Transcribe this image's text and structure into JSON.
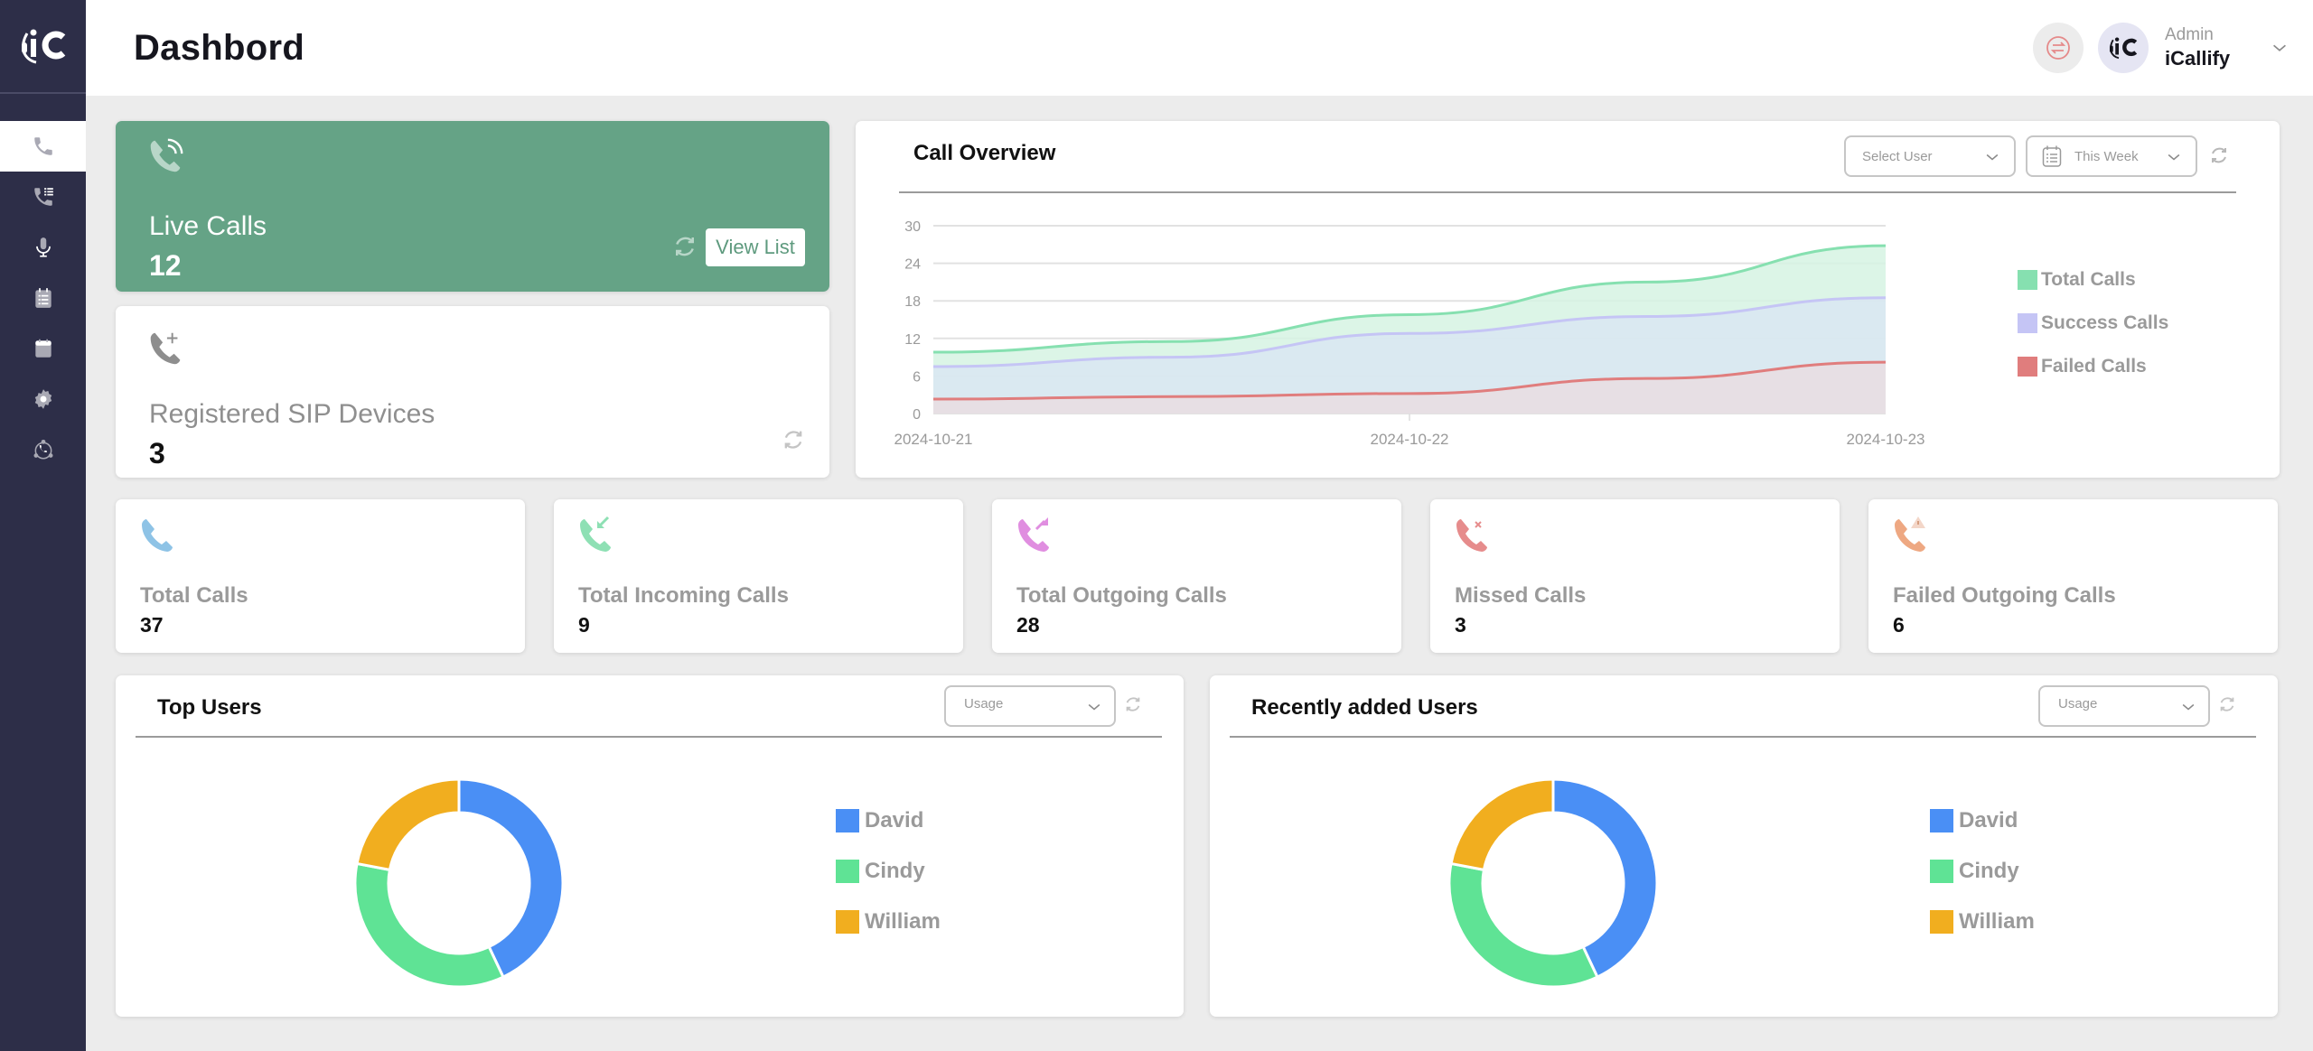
{
  "app": {
    "logo_text": "iC",
    "page_title": "Dashbord"
  },
  "sidebar": {
    "items": [
      {
        "name": "phone",
        "icon": "phone-icon",
        "active": true
      },
      {
        "name": "call-list",
        "icon": "phone-list-icon",
        "active": false
      },
      {
        "name": "recordings",
        "icon": "microphone-icon",
        "active": false
      },
      {
        "name": "reports",
        "icon": "clipboard-list-icon",
        "active": false
      },
      {
        "name": "calendar",
        "icon": "calendar-icon",
        "active": false
      },
      {
        "name": "settings",
        "icon": "gear-icon",
        "active": false
      },
      {
        "name": "network",
        "icon": "call-network-icon",
        "active": false
      }
    ]
  },
  "header": {
    "switch_icon": "swap-arrows-icon",
    "user_role": "Admin",
    "user_name": "iCallify",
    "avatar_text": "iC"
  },
  "live_calls": {
    "label": "Live Calls",
    "value": "12",
    "view_list_label": "View List",
    "color": "#65a386"
  },
  "sip_devices": {
    "label": "Registered SIP Devices",
    "value": "3"
  },
  "call_overview": {
    "title": "Call Overview",
    "select_user_placeholder": "Select User",
    "period_selected": "This Week"
  },
  "stats": [
    {
      "label": "Total Calls",
      "value": "37",
      "icon": "phone-icon",
      "color": "#8ec3e6"
    },
    {
      "label": "Total Incoming Calls",
      "value": "9",
      "icon": "phone-incoming-icon",
      "color": "#8ee0b4"
    },
    {
      "label": "Total Outgoing Calls",
      "value": "28",
      "icon": "phone-outgoing-icon",
      "color": "#e08ee0"
    },
    {
      "label": "Missed Calls",
      "value": "3",
      "icon": "phone-missed-icon",
      "color": "#e68c8c"
    },
    {
      "label": "Failed Outgoing Calls",
      "value": "6",
      "icon": "phone-failed-icon",
      "color": "#eea882"
    }
  ],
  "top_users": {
    "title": "Top Users",
    "filter_selected": "Usage"
  },
  "recent_users": {
    "title": "Recently added Users",
    "filter_selected": "Usage"
  },
  "chart_data": [
    {
      "type": "area",
      "title": "Call Overview",
      "x": [
        "2024-10-21",
        "2024-10-21 12:00",
        "2024-10-22",
        "2024-10-22 12:00",
        "2024-10-23"
      ],
      "xticks": [
        "2024-10-21",
        "2024-10-22",
        "2024-10-23"
      ],
      "yticks": [
        0,
        6,
        12,
        18,
        24,
        30
      ],
      "ylim": [
        0,
        30
      ],
      "grid": true,
      "legend_position": "right",
      "series": [
        {
          "name": "Total Calls",
          "color": "#86e0b0",
          "fill": "#d6f3e3",
          "values": [
            9.8,
            11.5,
            15.8,
            21,
            26.8
          ]
        },
        {
          "name": "Success Calls",
          "color": "#c5c5f5",
          "fill": "#d9e6f2",
          "values": [
            7.5,
            9.0,
            12.8,
            15.5,
            18.5
          ]
        },
        {
          "name": "Failed Calls",
          "color": "#e07d7d",
          "fill": "#e9dde2",
          "values": [
            2.3,
            2.7,
            3.2,
            5.6,
            8.2
          ]
        }
      ]
    },
    {
      "type": "pie",
      "title": "Top Users",
      "donut": true,
      "legend_position": "right",
      "categories": [
        "David",
        "Cindy",
        "William"
      ],
      "values": [
        43,
        35,
        22
      ],
      "colors": [
        "#4a8ff5",
        "#5fe395",
        "#f1ae1f"
      ]
    },
    {
      "type": "pie",
      "title": "Recently added Users",
      "donut": true,
      "legend_position": "right",
      "categories": [
        "David",
        "Cindy",
        "William"
      ],
      "values": [
        43,
        35,
        22
      ],
      "colors": [
        "#4a8ff5",
        "#5fe395",
        "#f1ae1f"
      ]
    }
  ]
}
